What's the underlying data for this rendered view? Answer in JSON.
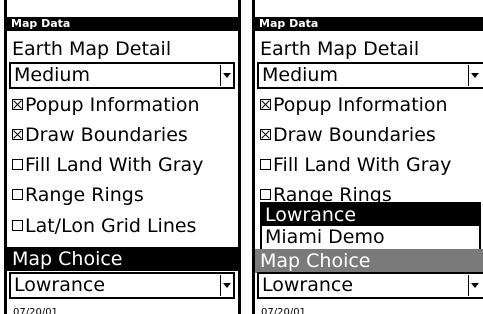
{
  "left": {
    "title": "Map Data",
    "section_label": "Earth Map Detail",
    "detail_value": "Medium",
    "options": [
      {
        "label": "Popup Information",
        "checked": true
      },
      {
        "label": "Draw Boundaries",
        "checked": true
      },
      {
        "label": "Fill Land With Gray",
        "checked": false
      },
      {
        "label": "Range Rings",
        "checked": false
      },
      {
        "label": "Lat/Lon Grid Lines",
        "checked": false
      }
    ],
    "map_choice_label": "Map Choice",
    "map_choice_value": "Lowrance",
    "status_text": "07/20/01"
  },
  "right": {
    "title": "Map Data",
    "section_label": "Earth Map Detail",
    "detail_value": "Medium",
    "options": [
      {
        "label": "Popup Information",
        "checked": true
      },
      {
        "label": "Draw Boundaries",
        "checked": true
      },
      {
        "label": "Fill Land With Gray",
        "checked": false
      },
      {
        "label": "Range Rings",
        "checked": false
      }
    ],
    "popup_options": [
      "Lowrance",
      "Miami Demo"
    ],
    "popup_selected_index": 0,
    "map_choice_label": "Map Choice",
    "map_choice_value": "Lowrance",
    "status_text": "07/20/01"
  },
  "icons": {
    "checkbox_checked": "checkbox-checked-icon",
    "checkbox_unchecked": "checkbox-unchecked-icon",
    "dropdown_arrow": "chevron-down-icon"
  },
  "colors": {
    "highlight": "#000000",
    "highlight_dimmed": "#7a7a7a",
    "text": "#000000",
    "background": "#ffffff"
  }
}
